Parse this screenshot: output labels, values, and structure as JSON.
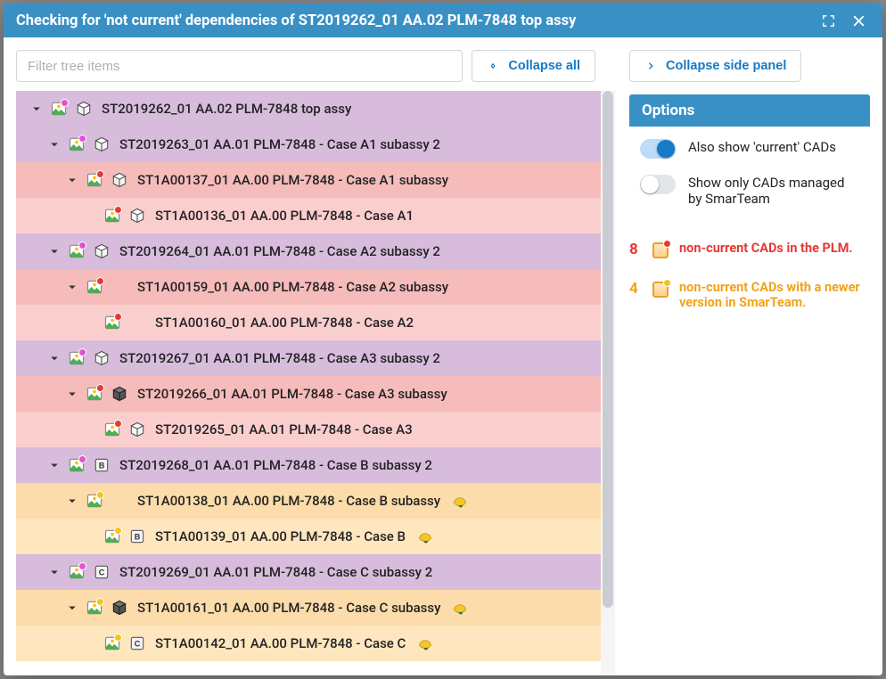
{
  "title": "Checking for 'not current' dependencies of ST2019262_01 AA.02 PLM-7848 top assy",
  "toolbar": {
    "filter_placeholder": "Filter tree items",
    "collapse_all": "Collapse all",
    "collapse_side": "Collapse side panel"
  },
  "tree": [
    {
      "depth": 0,
      "color": "purple",
      "chev": true,
      "dot": "mag",
      "geom": "light",
      "label": "ST2019262_01 AA.02 PLM-7848 top assy"
    },
    {
      "depth": 1,
      "color": "purple",
      "chev": true,
      "dot": "mag",
      "geom": "light",
      "label": "ST2019263_01 AA.01 PLM-7848 - Case A1 subassy 2"
    },
    {
      "depth": 2,
      "color": "red",
      "chev": true,
      "dot": "red",
      "geom": "light",
      "label": "ST1A00137_01 AA.00 PLM-7848 - Case A1 subassy"
    },
    {
      "depth": 3,
      "color": "redlt",
      "chev": false,
      "dot": "red",
      "geom": "light",
      "label": "ST1A00136_01 AA.00 PLM-7848 - Case A1"
    },
    {
      "depth": 1,
      "color": "purple",
      "chev": true,
      "dot": "mag",
      "geom": "light",
      "label": "ST2019264_01 AA.01 PLM-7848 - Case A2 subassy 2"
    },
    {
      "depth": 2,
      "color": "red",
      "chev": true,
      "dot": "red",
      "geom": "none",
      "label": "ST1A00159_01 AA.00 PLM-7848 - Case A2 subassy"
    },
    {
      "depth": 3,
      "color": "redlt",
      "chev": false,
      "dot": "red",
      "geom": "none",
      "label": "ST1A00160_01 AA.00 PLM-7848 - Case A2"
    },
    {
      "depth": 1,
      "color": "purple",
      "chev": true,
      "dot": "mag",
      "geom": "light",
      "label": "ST2019267_01 AA.01 PLM-7848 - Case A3 subassy 2"
    },
    {
      "depth": 2,
      "color": "red",
      "chev": true,
      "dot": "red",
      "geom": "dark",
      "label": "ST2019266_01 AA.01 PLM-7848 - Case A3 subassy"
    },
    {
      "depth": 3,
      "color": "redlt",
      "chev": false,
      "dot": "red",
      "geom": "light",
      "label": "ST2019265_01 AA.01 PLM-7848 - Case A3"
    },
    {
      "depth": 1,
      "color": "purple",
      "chev": true,
      "dot": "mag",
      "geom": "b",
      "label": "ST2019268_01 AA.01 PLM-7848 - Case B subassy 2"
    },
    {
      "depth": 2,
      "color": "yellow",
      "chev": true,
      "dot": "yel",
      "geom": "none",
      "label": "ST1A00138_01 AA.00 PLM-7848 - Case B subassy",
      "ds": true
    },
    {
      "depth": 3,
      "color": "yellowlt",
      "chev": false,
      "dot": "yel",
      "geom": "b",
      "label": "ST1A00139_01 AA.00 PLM-7848 - Case B",
      "ds": true
    },
    {
      "depth": 1,
      "color": "purple",
      "chev": true,
      "dot": "mag",
      "geom": "c",
      "label": "ST2019269_01 AA.01 PLM-7848 - Case C subassy 2"
    },
    {
      "depth": 2,
      "color": "yellow",
      "chev": true,
      "dot": "yel",
      "geom": "dark",
      "label": "ST1A00161_01 AA.00 PLM-7848 - Case C subassy",
      "ds": true
    },
    {
      "depth": 3,
      "color": "yellowlt",
      "chev": false,
      "dot": "yel",
      "geom": "c",
      "label": "ST1A00142_01 AA.00 PLM-7848 - Case C",
      "ds": true
    }
  ],
  "sidepanel": {
    "options_header": "Options",
    "opt1": "Also show 'current' CADs",
    "opt2": "Show only CADs managed by SmarTeam",
    "legend1_count": "8",
    "legend1_text": "non-current CADs in the PLM.",
    "legend2_count": "4",
    "legend2_text": "non-current CADs with a newer version in SmarTeam."
  }
}
